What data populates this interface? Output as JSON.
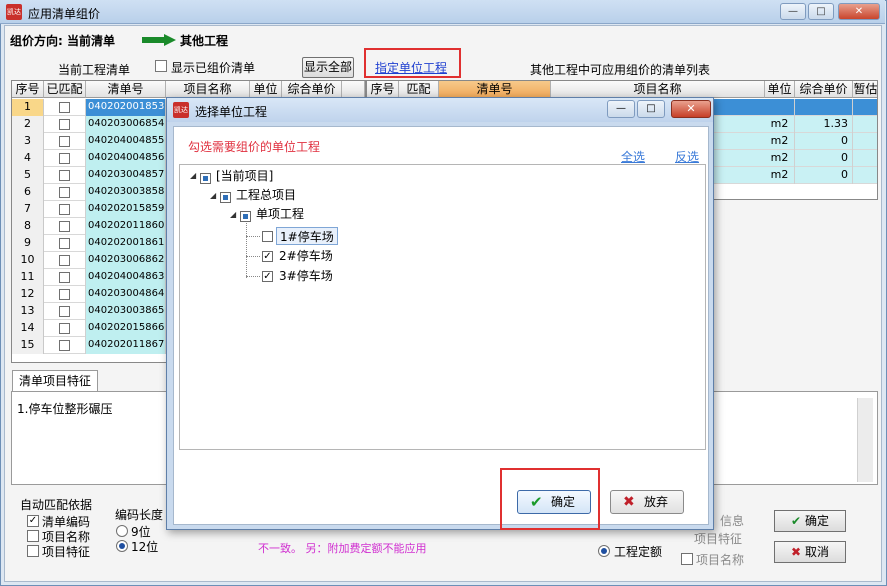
{
  "main_window": {
    "title": "应用清单组价",
    "icon_text": "凯达",
    "minimize": "—",
    "maximize": "□",
    "close": "✕"
  },
  "direction": {
    "label": "组价方向: 当前清单",
    "target": "其他工程"
  },
  "toolbar": {
    "current_list_label": "当前工程清单",
    "show_priced_label": "显示已组价清单",
    "show_all_button": "显示全部",
    "assign_unit_link": "指定单位工程",
    "other_list_label": "其他工程中可应用组价的清单列表"
  },
  "left_table": {
    "columns": [
      "序号",
      "已匹配",
      "清单号",
      "项目名称",
      "单位",
      "综合单价"
    ],
    "rows": [
      {
        "seq": "1",
        "code": "040202001853"
      },
      {
        "seq": "2",
        "code": "040203006854"
      },
      {
        "seq": "3",
        "code": "040204004855"
      },
      {
        "seq": "4",
        "code": "040204004856"
      },
      {
        "seq": "5",
        "code": "040203004857"
      },
      {
        "seq": "6",
        "code": "040203003858"
      },
      {
        "seq": "7",
        "code": "040202015859"
      },
      {
        "seq": "8",
        "code": "040202011860"
      },
      {
        "seq": "9",
        "code": "040202001861"
      },
      {
        "seq": "10",
        "code": "040203006862"
      },
      {
        "seq": "11",
        "code": "040204004863"
      },
      {
        "seq": "12",
        "code": "040203004864"
      },
      {
        "seq": "13",
        "code": "040203003865"
      },
      {
        "seq": "14",
        "code": "040202015866"
      },
      {
        "seq": "15",
        "code": "040202011867"
      }
    ]
  },
  "right_table": {
    "columns": [
      "序号",
      "匹配",
      "清单号",
      "项目名称",
      "单位",
      "综合单价",
      "暂估"
    ],
    "rows": [
      {
        "unit": "",
        "price": ""
      },
      {
        "unit": "m2",
        "price": "1.33"
      },
      {
        "unit": "m2",
        "price": "0"
      },
      {
        "unit": "m2",
        "price": "0"
      },
      {
        "unit": "m2",
        "price": "0"
      }
    ]
  },
  "features": {
    "tab_label": "清单项目特征",
    "text": "1.停车位整形碾压"
  },
  "bottom": {
    "auto_match_label": "自动匹配依据",
    "match_options": [
      {
        "label": "清单编码",
        "checked": true
      },
      {
        "label": "项目名称",
        "checked": false
      },
      {
        "label": "项目特征",
        "checked": false
      }
    ],
    "code_length_label": "编码长度",
    "length_options": [
      {
        "label": "9位",
        "selected": false
      },
      {
        "label": "12位",
        "selected": true
      }
    ],
    "warning": "不一致。 另：附加费定额不能应用",
    "quota_option": "工程定额",
    "item_feature_option": "项目特征",
    "item_name_option": "项目名称",
    "info_text": "信息",
    "ok_button": "确定",
    "cancel_button": "取消"
  },
  "dialog": {
    "title": "选择单位工程",
    "hint": "勾选需要组价的单位工程",
    "select_all": "全选",
    "invert_select": "反选",
    "tree": {
      "root": "[当前项目]",
      "project": "工程总项目",
      "single": "单项工程",
      "units": [
        {
          "label": "1#停车场",
          "checked": false
        },
        {
          "label": "2#停车场",
          "checked": true
        },
        {
          "label": "3#停车场",
          "checked": true
        }
      ]
    },
    "ok_button": "确定",
    "cancel_button": "放弃",
    "minimize": "—",
    "maximize": "□",
    "close": "✕"
  },
  "colors": {
    "highlight_red": "#e03030",
    "link_blue": "#1f3fd0",
    "hint_red": "#e0303f",
    "selected_row": "#3c8fd6",
    "code_cell": "#bfeff0"
  }
}
